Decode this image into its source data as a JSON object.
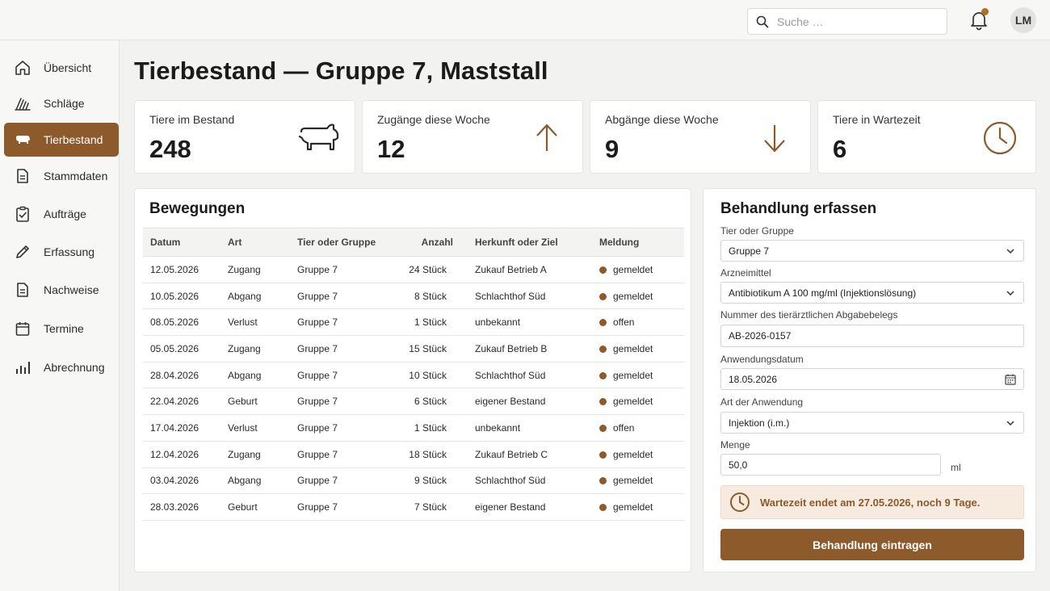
{
  "header": {
    "search_placeholder": "Suche …",
    "avatar_initials": "LM",
    "notification_badge_color": "#b06f22"
  },
  "sidebar": {
    "items": [
      {
        "label": "Übersicht",
        "icon": "home-icon"
      },
      {
        "label": "Schläge",
        "icon": "field-icon"
      },
      {
        "label": "Tierbestand",
        "icon": "animal-icon",
        "active": true
      },
      {
        "label": "Stammdaten",
        "icon": "document-icon"
      },
      {
        "label": "Aufträge",
        "icon": "clipboard-check-icon"
      },
      {
        "label": "Erfassung",
        "icon": "pencil-icon"
      },
      {
        "label": "Nachweise",
        "icon": "document-icon"
      },
      {
        "label": "Termine",
        "icon": "calendar-icon"
      },
      {
        "label": "Abrechnung",
        "icon": "bar-chart-icon"
      }
    ]
  },
  "page": {
    "title": "Tierbestand — Gruppe 7, Maststall"
  },
  "kpis": [
    {
      "label": "Tiere im Bestand",
      "value": "248",
      "icon": "pig-icon"
    },
    {
      "label": "Zugänge diese Woche",
      "value": "12",
      "icon": "arrow-up-icon"
    },
    {
      "label": "Abgänge diese Woche",
      "value": "9",
      "icon": "arrow-down-icon"
    },
    {
      "label": "Tiere in Wartezeit",
      "value": "6",
      "icon": "clock-icon"
    }
  ],
  "movements": {
    "title": "Bewegungen",
    "columns": [
      "Datum",
      "Art",
      "Tier oder Gruppe",
      "Anzahl",
      "Herkunft oder Ziel",
      "Meldung"
    ],
    "rows": [
      {
        "datum": "12.05.2026",
        "art": "Zugang",
        "gruppe": "Gruppe 7",
        "anzahl": "24 Stück",
        "herkunft": "Zukauf Betrieb A",
        "meldung": "gemeldet"
      },
      {
        "datum": "10.05.2026",
        "art": "Abgang",
        "gruppe": "Gruppe 7",
        "anzahl": "8 Stück",
        "herkunft": "Schlachthof Süd",
        "meldung": "gemeldet"
      },
      {
        "datum": "08.05.2026",
        "art": "Verlust",
        "gruppe": "Gruppe 7",
        "anzahl": "1 Stück",
        "herkunft": "unbekannt",
        "meldung": "offen"
      },
      {
        "datum": "05.05.2026",
        "art": "Zugang",
        "gruppe": "Gruppe 7",
        "anzahl": "15 Stück",
        "herkunft": "Zukauf Betrieb B",
        "meldung": "gemeldet"
      },
      {
        "datum": "28.04.2026",
        "art": "Abgang",
        "gruppe": "Gruppe 7",
        "anzahl": "10 Stück",
        "herkunft": "Schlachthof Süd",
        "meldung": "gemeldet"
      },
      {
        "datum": "22.04.2026",
        "art": "Geburt",
        "gruppe": "Gruppe 7",
        "anzahl": "6 Stück",
        "herkunft": "eigener Bestand",
        "meldung": "gemeldet"
      },
      {
        "datum": "17.04.2026",
        "art": "Verlust",
        "gruppe": "Gruppe 7",
        "anzahl": "1 Stück",
        "herkunft": "unbekannt",
        "meldung": "offen"
      },
      {
        "datum": "12.04.2026",
        "art": "Zugang",
        "gruppe": "Gruppe 7",
        "anzahl": "18 Stück",
        "herkunft": "Zukauf Betrieb C",
        "meldung": "gemeldet"
      },
      {
        "datum": "03.04.2026",
        "art": "Abgang",
        "gruppe": "Gruppe 7",
        "anzahl": "9 Stück",
        "herkunft": "Schlachthof Süd",
        "meldung": "gemeldet"
      },
      {
        "datum": "28.03.2026",
        "art": "Geburt",
        "gruppe": "Gruppe 7",
        "anzahl": "7 Stück",
        "herkunft": "eigener Bestand",
        "meldung": "gemeldet"
      }
    ],
    "status_dot_color": "#8c5a2b"
  },
  "treatment": {
    "title": "Behandlung erfassen",
    "fields": {
      "tier": {
        "label": "Tier oder Gruppe",
        "value": "Gruppe 7"
      },
      "arznei": {
        "label": "Arzneimittel",
        "value": "Antibiotikum A 100 mg/ml (Injektionslösung)"
      },
      "beleg": {
        "label": "Nummer des tierärztlichen Abgabebelegs",
        "value": "AB-2026-0157"
      },
      "datum": {
        "label": "Anwendungsdatum",
        "value": "18.05.2026"
      },
      "art": {
        "label": "Art der Anwendung",
        "value": "Injektion (i.m.)"
      },
      "menge": {
        "label": "Menge",
        "value": "50,0",
        "unit": "ml"
      }
    },
    "alert": "Wartezeit endet am 27.05.2026, noch 9 Tage.",
    "submit_label": "Behandlung eintragen"
  },
  "colors": {
    "accent": "#8c5a2b",
    "alert_bg": "#f7ebe0"
  }
}
